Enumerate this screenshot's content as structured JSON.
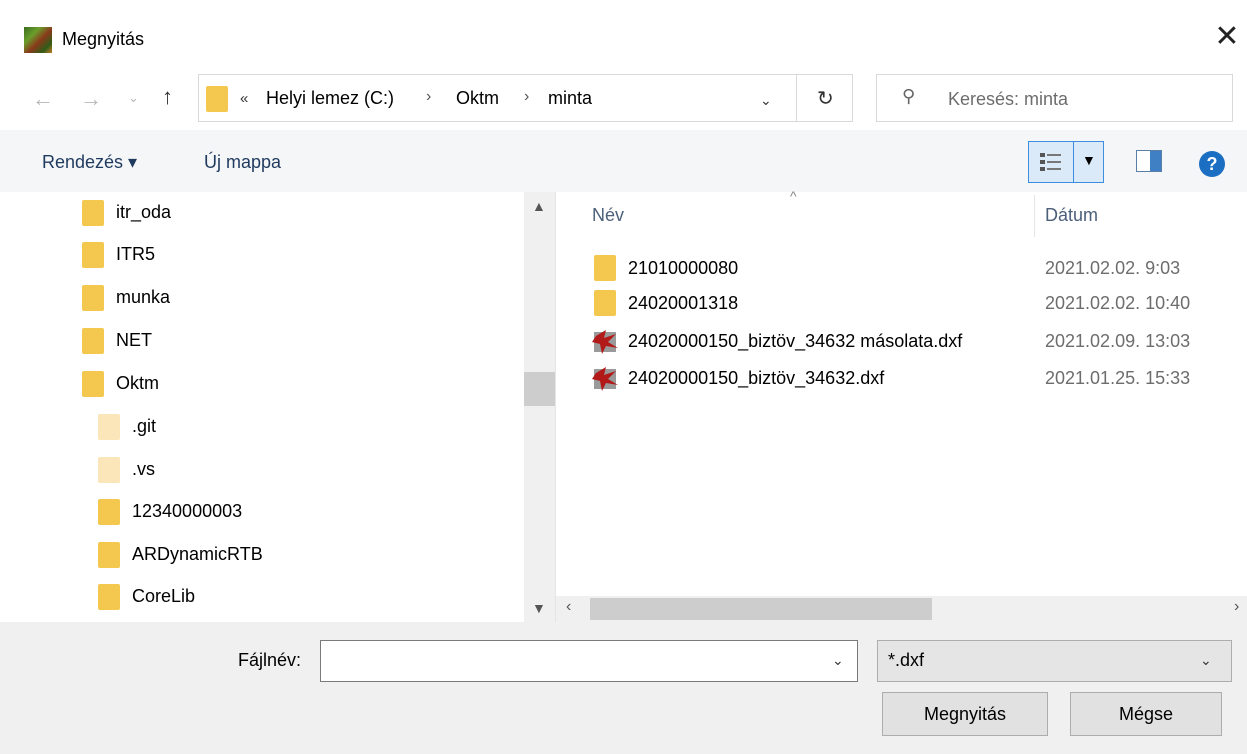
{
  "window": {
    "title": "Megnyitás"
  },
  "address": {
    "overflow": "«",
    "crumbs": [
      "Helyi lemez (C:)",
      "Oktm",
      "minta"
    ]
  },
  "search": {
    "placeholder": "Keresés: minta"
  },
  "toolbar": {
    "organize": "Rendezés ▾",
    "new_folder": "Új mappa"
  },
  "tree": {
    "items": [
      {
        "label": "itr_oda",
        "style": "normal"
      },
      {
        "label": "ITR5",
        "style": "normal"
      },
      {
        "label": "munka",
        "style": "normal"
      },
      {
        "label": "NET",
        "style": "normal"
      },
      {
        "label": "Oktm",
        "style": "normal"
      },
      {
        "label": ".git",
        "style": "hidden"
      },
      {
        "label": ".vs",
        "style": "hidden"
      },
      {
        "label": "12340000003",
        "style": "normal"
      },
      {
        "label": "ARDynamicRTB",
        "style": "normal"
      },
      {
        "label": "CoreLib",
        "style": "normal"
      }
    ]
  },
  "list": {
    "columns": {
      "name": "Név",
      "date": "Dátum"
    },
    "rows": [
      {
        "name": "21010000080",
        "date": "2021.02.02. 9:03",
        "kind": "folder"
      },
      {
        "name": "24020001318",
        "date": "2021.02.02. 10:40",
        "kind": "folder"
      },
      {
        "name": "24020000150_biztöv_34632 másolata.dxf",
        "date": "2021.02.09. 13:03",
        "kind": "dxf"
      },
      {
        "name": "24020000150_biztöv_34632.dxf",
        "date": "2021.01.25. 15:33",
        "kind": "dxf"
      }
    ]
  },
  "footer": {
    "filename_label": "Fájlnév:",
    "filename_value": "",
    "filter_value": "*.dxf",
    "open_button": "Megnyitás",
    "cancel_button": "Mégse"
  },
  "colors": {
    "folder": "#f4c84f",
    "accent": "#1b6ec2"
  }
}
